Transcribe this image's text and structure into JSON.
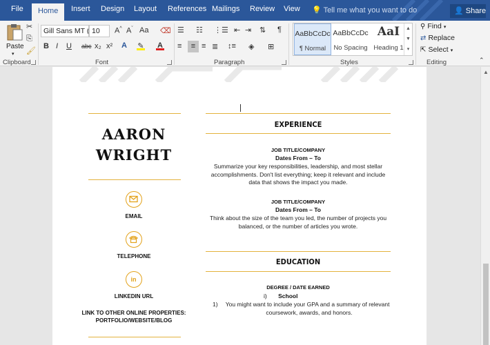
{
  "tabs": [
    {
      "label": "File",
      "active": false
    },
    {
      "label": "Home",
      "active": true
    },
    {
      "label": "Insert",
      "active": false
    },
    {
      "label": "Design",
      "active": false
    },
    {
      "label": "Layout",
      "active": false
    },
    {
      "label": "References",
      "active": false
    },
    {
      "label": "Mailings",
      "active": false
    },
    {
      "label": "Review",
      "active": false
    },
    {
      "label": "View",
      "active": false
    }
  ],
  "tell_me": "Tell me what you want to do",
  "share_label": "Share",
  "ribbon": {
    "clipboard": {
      "label": "Clipboard",
      "paste": "Paste"
    },
    "font": {
      "label": "Font",
      "font_name": "Gill Sans MT (E",
      "font_size": "10",
      "bold": "B",
      "italic": "I",
      "underline": "U",
      "strike": "abc",
      "sub": "x₂",
      "sup": "x²",
      "aa": "Aa"
    },
    "paragraph": {
      "label": "Paragraph"
    },
    "styles": {
      "label": "Styles",
      "items": [
        {
          "sample": "AaBbCcDc",
          "name": "¶ Normal",
          "selected": true
        },
        {
          "sample": "AaBbCcDc",
          "name": "No Spacing",
          "selected": false
        },
        {
          "sample": "AaI",
          "name": "Heading 1",
          "selected": false
        }
      ]
    },
    "editing": {
      "label": "Editing",
      "find": "Find",
      "replace": "Replace",
      "select": "Select"
    }
  },
  "document": {
    "name_line1": "AARON",
    "name_line2": "WRIGHT",
    "contacts": [
      {
        "label": "EMAIL",
        "icon": "envelope-icon"
      },
      {
        "label": "TELEPHONE",
        "icon": "telephone-icon"
      },
      {
        "label": "LINKEDIN URL",
        "icon": "linkedin-icon"
      }
    ],
    "other_links_line1": "LINK TO OTHER ONLINE PROPERTIES:",
    "other_links_line2": "PORTFOLIO/WEBSITE/BLOG",
    "experience_title": "EXPERIENCE",
    "jobs": [
      {
        "title": "JOB TITLE/COMPANY",
        "dates": "Dates From – To",
        "desc_line1": "Summarize your key responsibilities, leadership, and most stellar",
        "desc_line2": "accomplishments. Don't list everything; keep it relevant and include",
        "desc_line3": "data that shows the impact you made."
      },
      {
        "title": "JOB TITLE/COMPANY",
        "dates": "Dates From – To",
        "desc_line1": "Think about the size of the team you led, the number of projects you",
        "desc_line2": "balanced, or the number of articles you wrote.",
        "desc_line3": ""
      }
    ],
    "education_title": "EDUCATION",
    "degree": "DEGREE / DATE EARNED",
    "school_marker": "i)",
    "school": "School",
    "edu_item_marker": "1)",
    "edu_desc_line1": "You might want to include your GPA and a summary of relevant",
    "edu_desc_line2": "coursework, awards, and honors."
  },
  "colors": {
    "accent": "#e3b23c",
    "ribbon_blue": "#2b579a"
  }
}
